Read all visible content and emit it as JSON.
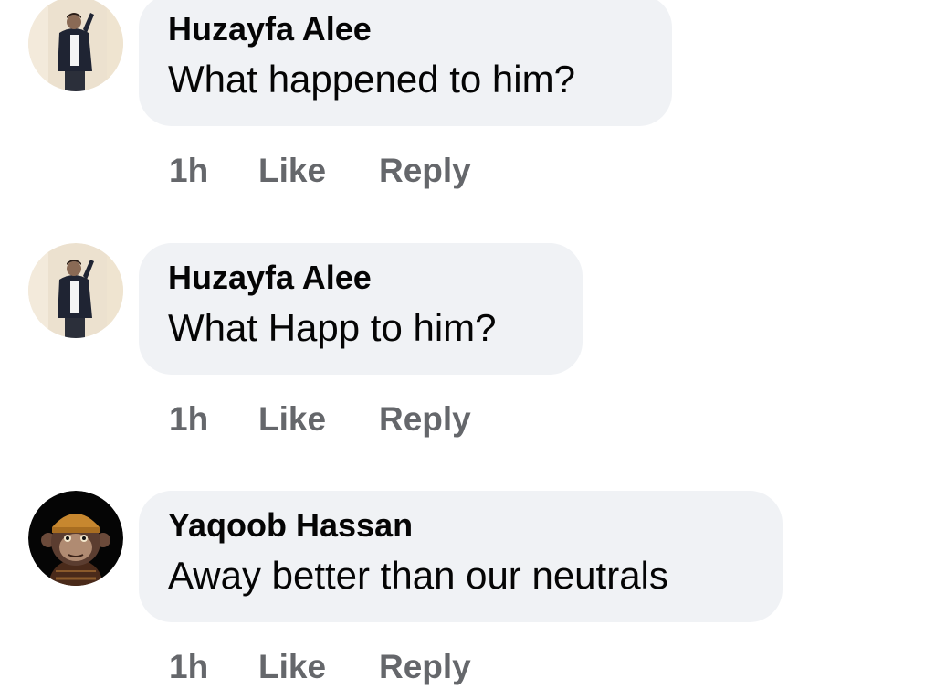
{
  "comments": [
    {
      "author": "Huzayfa Alee",
      "text": "What happened to him?",
      "avatar_icon": "profile-photo-man-standing-icon",
      "time": "1h",
      "like_label": "Like",
      "reply_label": "Reply"
    },
    {
      "author": "Huzayfa Alee",
      "text": "What Happ to him?",
      "avatar_icon": "profile-photo-man-standing-icon",
      "time": "1h",
      "like_label": "Like",
      "reply_label": "Reply"
    },
    {
      "author": "Yaqoob Hassan",
      "text": "Away better than our neutrals",
      "avatar_icon": "profile-photo-ape-nft-icon",
      "time": "1h",
      "like_label": "Like",
      "reply_label": "Reply"
    }
  ],
  "colors": {
    "bubble": "#f0f2f5",
    "text": "#050505",
    "meta": "#65676b"
  }
}
